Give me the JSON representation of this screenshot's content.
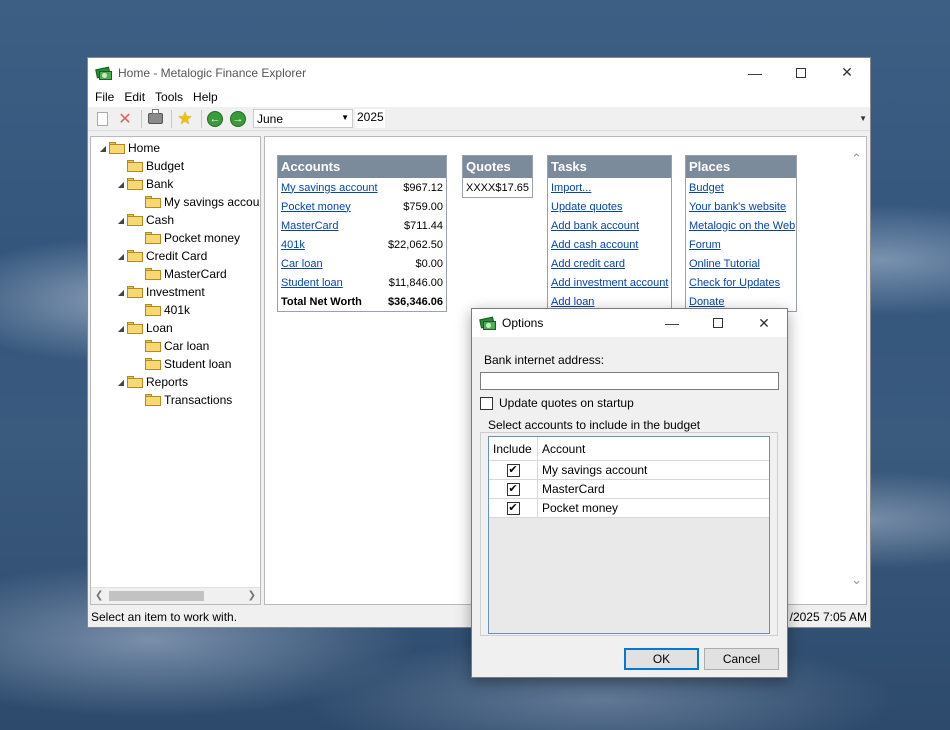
{
  "main_window": {
    "title": "Home - Metalogic Finance Explorer",
    "menu": [
      "File",
      "Edit",
      "Tools",
      "Help"
    ],
    "toolbar": {
      "month": "June",
      "year": "2025"
    },
    "tree": [
      {
        "label": "Home",
        "level": 0,
        "expanded": true
      },
      {
        "label": "Budget",
        "level": 1,
        "expanded": null
      },
      {
        "label": "Bank",
        "level": 1,
        "expanded": true
      },
      {
        "label": "My savings account",
        "level": 2,
        "expanded": null
      },
      {
        "label": "Cash",
        "level": 1,
        "expanded": true
      },
      {
        "label": "Pocket money",
        "level": 2,
        "expanded": null
      },
      {
        "label": "Credit Card",
        "level": 1,
        "expanded": true
      },
      {
        "label": "MasterCard",
        "level": 2,
        "expanded": null
      },
      {
        "label": "Investment",
        "level": 1,
        "expanded": true
      },
      {
        "label": "401k",
        "level": 2,
        "expanded": null
      },
      {
        "label": "Loan",
        "level": 1,
        "expanded": true
      },
      {
        "label": "Car loan",
        "level": 2,
        "expanded": null
      },
      {
        "label": "Student loan",
        "level": 2,
        "expanded": null
      },
      {
        "label": "Reports",
        "level": 1,
        "expanded": true
      },
      {
        "label": "Transactions",
        "level": 2,
        "expanded": null
      }
    ],
    "accounts": {
      "title": "Accounts",
      "rows": [
        {
          "name": "My savings account",
          "amount": "$967.12"
        },
        {
          "name": "Pocket money",
          "amount": "$759.00"
        },
        {
          "name": "MasterCard",
          "amount": "$711.44"
        },
        {
          "name": "401k",
          "amount": "$22,062.50"
        },
        {
          "name": "Car loan",
          "amount": "$0.00"
        },
        {
          "name": "Student loan",
          "amount": "$11,846.00"
        }
      ],
      "total_label": "Total Net Worth",
      "total_amount": "$36,346.06"
    },
    "quotes": {
      "title": "Quotes",
      "rows": [
        {
          "symbol": "XXXX",
          "price": "$17.65"
        }
      ]
    },
    "tasks": {
      "title": "Tasks",
      "items": [
        "Import...",
        "Update quotes",
        "Add bank account",
        "Add cash account",
        "Add credit card",
        "Add investment account",
        "Add loan"
      ]
    },
    "places": {
      "title": "Places",
      "items": [
        "Budget",
        "Your bank's website",
        "Metalogic on the Web",
        "Forum",
        "Online Tutorial",
        "Check for Updates",
        "Donate"
      ]
    },
    "status": {
      "left": "Select an item to work with.",
      "right": "/2025  7:05 AM"
    }
  },
  "dialog": {
    "title": "Options",
    "bank_label": "Bank internet address:",
    "bank_value": "",
    "update_quotes_label": "Update quotes on startup",
    "update_quotes_checked": false,
    "group_label": "Select accounts to include in the budget",
    "grid_headers": [
      "Include",
      "Account"
    ],
    "grid_rows": [
      {
        "include": true,
        "account": "My savings account"
      },
      {
        "include": true,
        "account": "MasterCard"
      },
      {
        "include": true,
        "account": "Pocket money"
      }
    ],
    "ok_label": "OK",
    "cancel_label": "Cancel"
  },
  "icons": {
    "app": "money-icon",
    "new": "new-document-icon",
    "delete": "delete-icon",
    "print": "printer-icon",
    "favorite": "star-icon",
    "back": "back-arrow-icon",
    "forward": "forward-arrow-icon",
    "folder": "folder-icon"
  }
}
